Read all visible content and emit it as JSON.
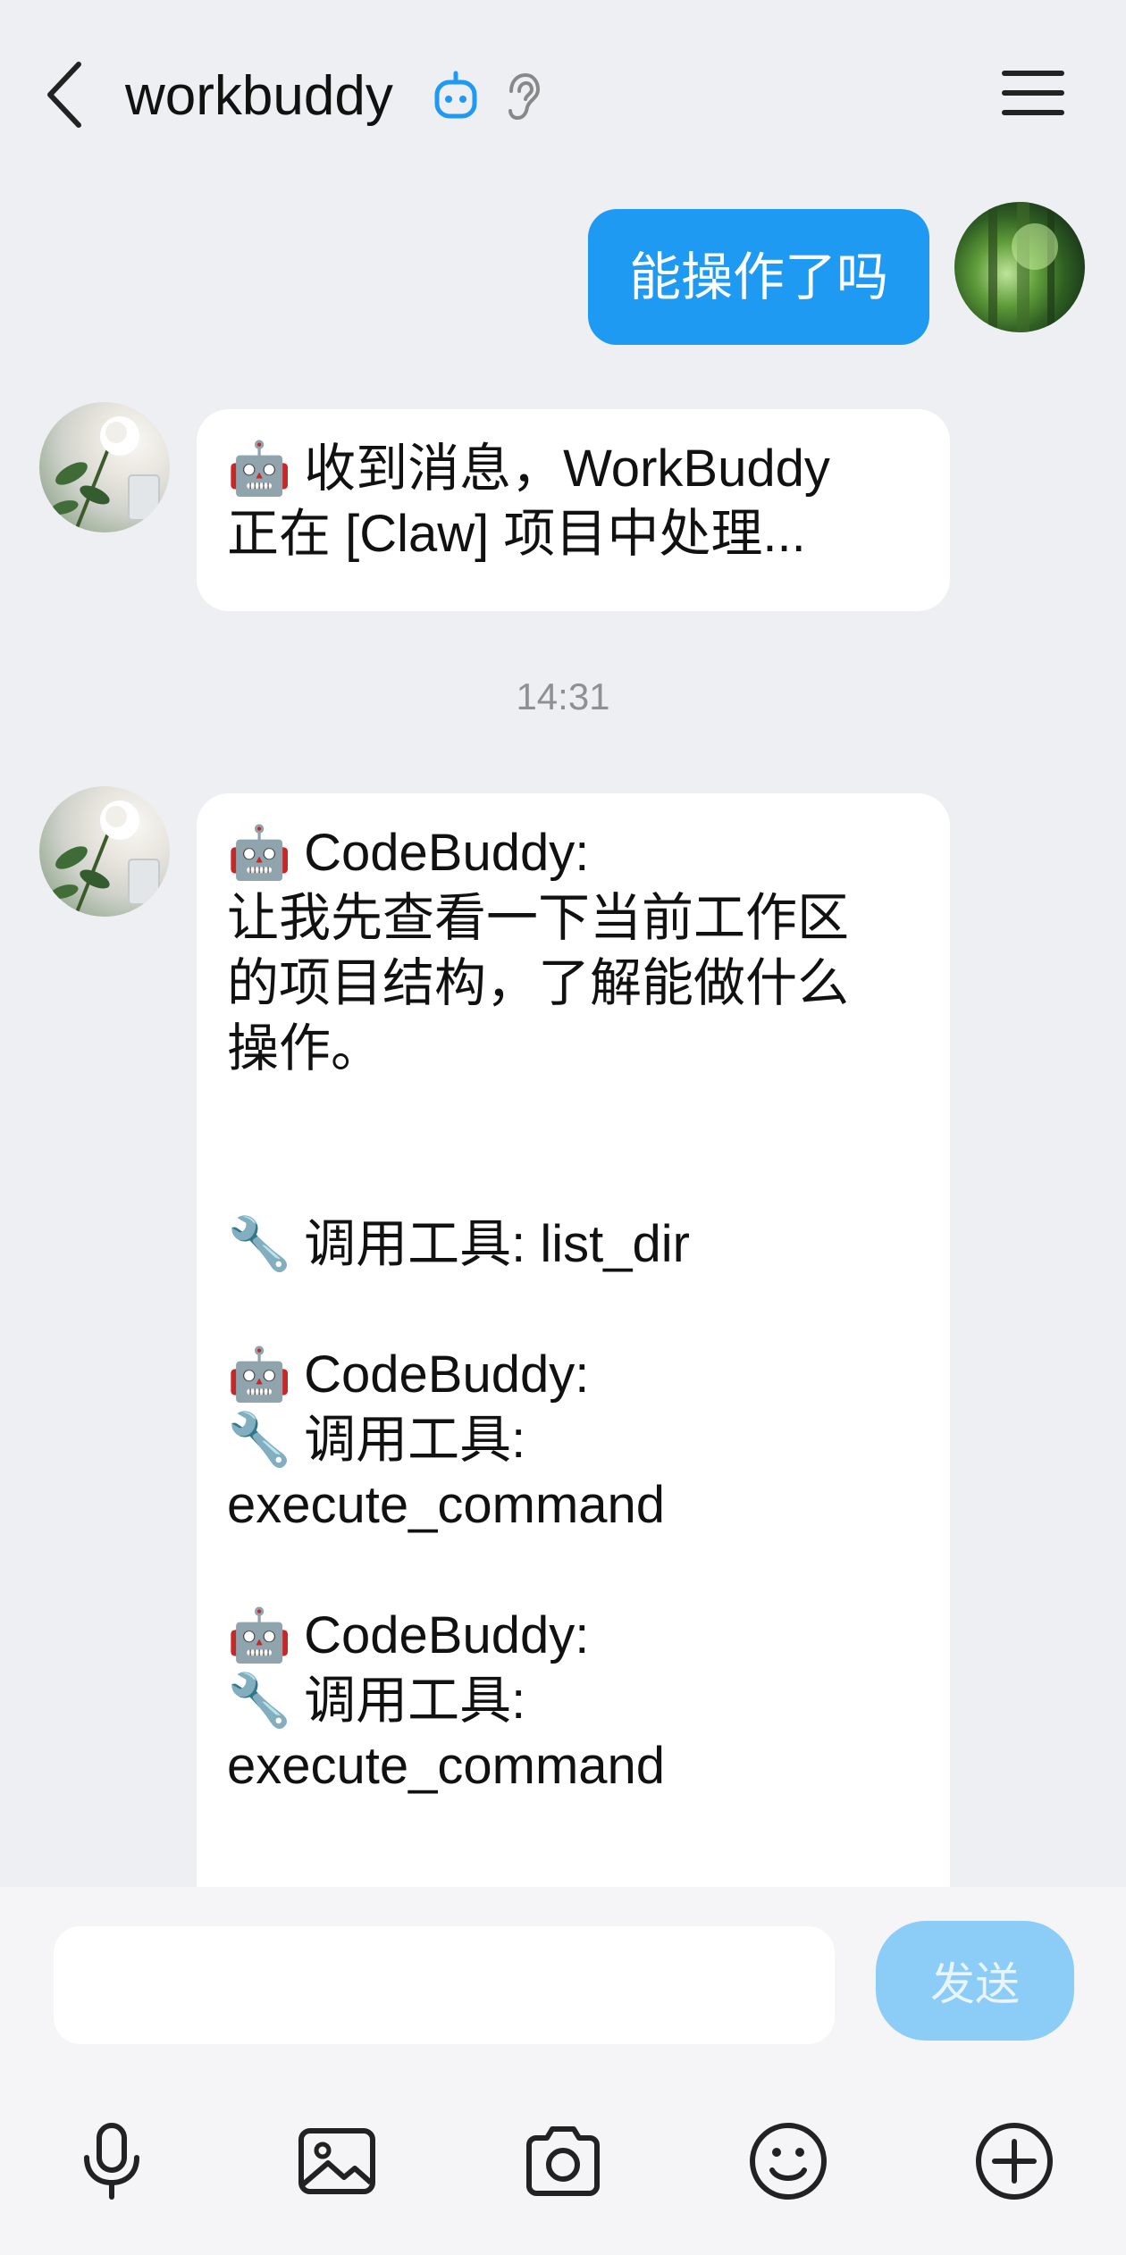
{
  "header": {
    "title": "workbuddy"
  },
  "messages": {
    "user_1": "能操作了吗",
    "bot_1": {
      "lines": [
        "🤖",
        " 收到消息，WorkBuddy",
        "正在 [Claw] 项目中处理..."
      ]
    },
    "timestamp": "14:31",
    "bot_2": {
      "l1_icon": "🤖",
      "l1_text": " CodeBuddy:",
      "l2": "让我先查看一下当前工作区",
      "l3": "的项目结构，了解能做什么",
      "l4": "操作。",
      "t1_icon": "🔧",
      "t1_text": " 调用工具: list_dir",
      "b2_icon": "🤖",
      "b2_text": " CodeBuddy:",
      "t2_icon": "🔧",
      "t2_text": " 调用工具:",
      "t2_cmd": "execute_command",
      "b3_icon": "🤖",
      "b3_text": " CodeBuddy:",
      "t3_icon": "🔧",
      "t3_text": " 调用工具:",
      "t3_cmd": "execute_command"
    }
  },
  "composer": {
    "input_value": "",
    "send_label": "发送"
  },
  "toolbar": {
    "icons": [
      "microphone-icon",
      "image-icon",
      "camera-icon",
      "emoji-icon",
      "plus-icon"
    ]
  },
  "colors": {
    "accent": "#1e9af3",
    "send_disabled": "#8ccdf8",
    "background": "#eeeff3"
  }
}
